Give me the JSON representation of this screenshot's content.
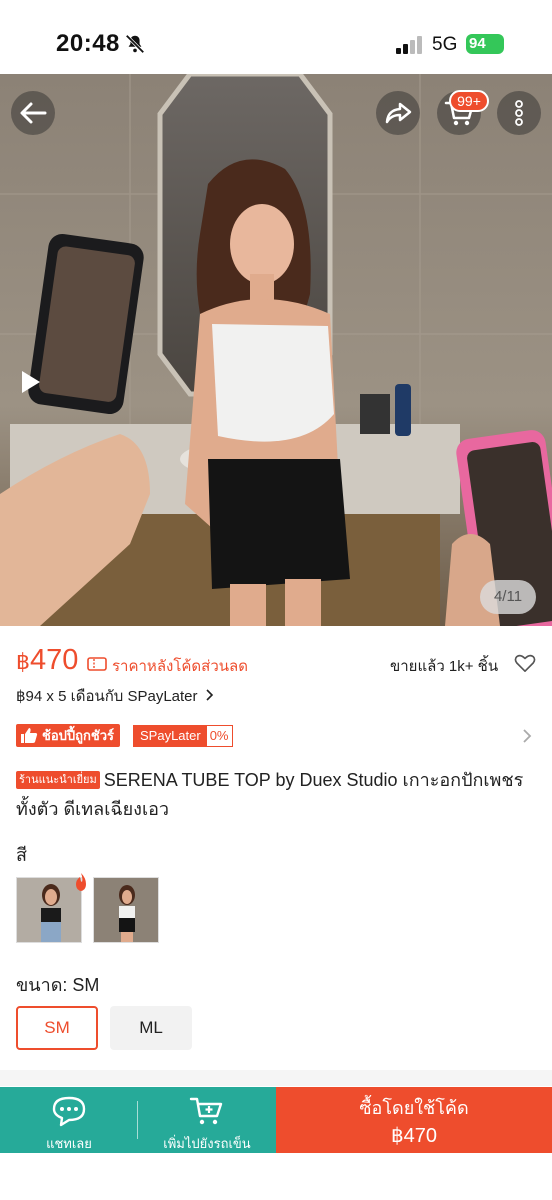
{
  "status_bar": {
    "time": "20:48",
    "network": "5G",
    "battery": "94"
  },
  "header": {
    "cart_count": "99+"
  },
  "gallery": {
    "counter": "4/11"
  },
  "price": {
    "currency": "฿",
    "amount": "470",
    "note": "ราคาหลังโค้ดส่วนลด"
  },
  "sold": "ขายแล้ว 1k+ ชิ้น",
  "installment": "฿94 x 5 เดือนกับ SPayLater",
  "badges": {
    "mall": "ช้อปปี้ถูกชัวร์",
    "spay": "SPayLater",
    "spay_rate": "0%"
  },
  "product": {
    "tag": "ร้านแนะนำเยี่ยม",
    "title": "SERENA TUBE TOP by Duex Studio เกาะอกปักเพชรทั้งตัว ดีเทลเฉียงเอว"
  },
  "variants": {
    "color_label": "สี",
    "size_label": "ขนาด: SM",
    "sizes": [
      "SM",
      "ML"
    ]
  },
  "bottom_bar": {
    "chat_label": "แชทเลย",
    "add_to_cart_label": "เพิ่มไปยังรถเข็น",
    "buy_label": "ซื้อโดยใช้โค้ด",
    "buy_price": "฿470"
  },
  "colors": {
    "accent": "#ee4d2d",
    "teal": "#26aa99"
  }
}
